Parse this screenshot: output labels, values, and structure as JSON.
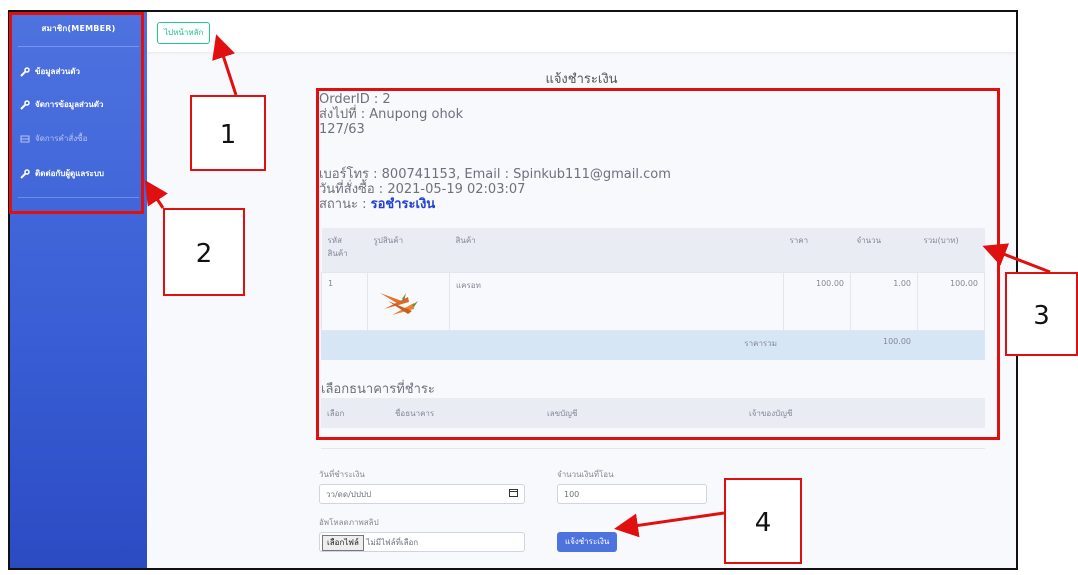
{
  "sidebar": {
    "brand": "สมาชิก(MEMBER)",
    "items": [
      {
        "label": "ข้อมูลส่วนตัว",
        "icon": "wrench-icon"
      },
      {
        "label": "จัดการข้อมูลส่วนตัว",
        "icon": "wrench-icon"
      },
      {
        "label": "จัดการคำสั่งซื้อ",
        "icon": "table-icon"
      },
      {
        "label": "ติดต่อกับผู้ดูแลระบบ",
        "icon": "wrench-icon"
      }
    ]
  },
  "topbar": {
    "home_label": "ไปหน้าหลัก"
  },
  "page": {
    "title": "แจ้งชำระเงิน"
  },
  "order": {
    "order_id": "OrderID : 2",
    "ship_to": "ส่งไปที่ : Anupong ohok",
    "address": "127/63",
    "contact": "เบอร์โทร : 800741153, Email : Spinkub111@gmail.com",
    "order_date": "วันที่สั่งซื้อ : 2021-05-19 02:03:07",
    "status_label": "สถานะ : ",
    "status_value": "รอชำระเงิน"
  },
  "items_table": {
    "headers": [
      "รหัส สินค้า",
      "รูปสินค้า",
      "สินค้า",
      "ราคา",
      "จำนวน",
      "รวม(บาท)"
    ],
    "rows": [
      {
        "id": "1",
        "name": "แครอท",
        "price": "100.00",
        "qty": "1.00",
        "total": "100.00"
      }
    ],
    "sum_label": "ราคารวม",
    "sum_value": "100.00"
  },
  "bank": {
    "title": "เลือกธนาคารที่ชำระ",
    "headers": [
      "เลือก",
      "ชื่อธนาคาร",
      "เลขบัญชี",
      "เจ้าของบัญชี"
    ]
  },
  "form": {
    "date_label": "วันที่ชำระเงิน",
    "date_placeholder": "วว/ดด/ปปปป",
    "amount_label": "จำนวนเงินที่โอน",
    "amount_value": "100",
    "upload_label": "อัพโหลดภาพสลิป",
    "file_button": "เลือกไฟล์",
    "file_status": "ไม่มีไฟล์ที่เลือก",
    "submit_label": "แจ้งชำระเงิน"
  },
  "annotations": [
    "1",
    "2",
    "3",
    "4"
  ],
  "colors": {
    "annotation": "#e01010",
    "sidebar": "#4e73df",
    "accent": "#1cc88a"
  }
}
